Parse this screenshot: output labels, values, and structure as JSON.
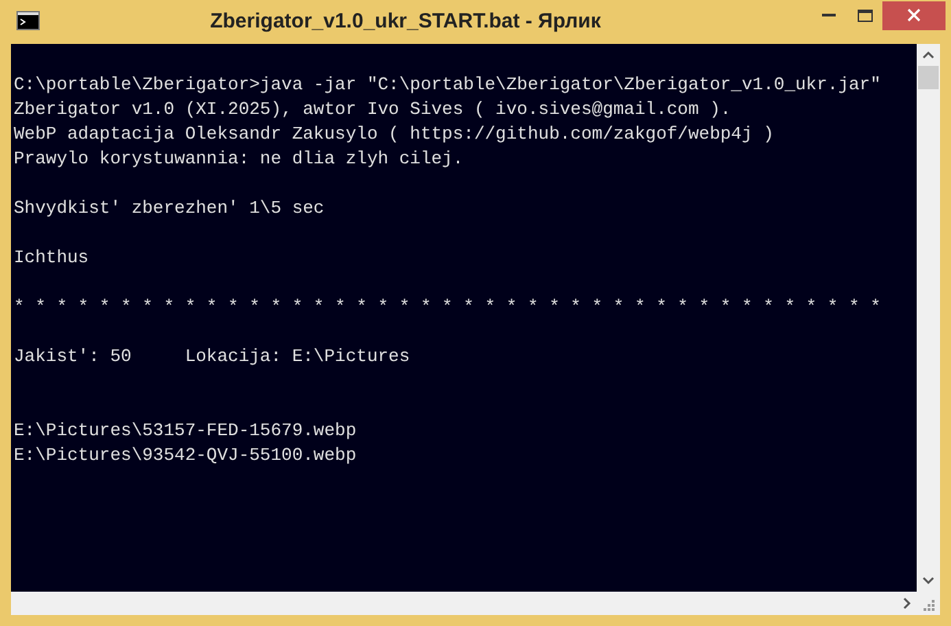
{
  "window": {
    "title": "Zberigator_v1.0_ukr_START.bat - Ярлик"
  },
  "console": {
    "lines": [
      {
        "kind": "blank"
      },
      {
        "kind": "text",
        "text": "C:\\portable\\Zberigator>java -jar \"C:\\portable\\Zberigator\\Zberigator_v1.0_ukr.jar\""
      },
      {
        "kind": "text",
        "text": "Zberigator v1.0 (XI.2025), awtor Ivo Sives ( ivo.sives@gmail.com )."
      },
      {
        "kind": "text",
        "text": "WebP adaptacija Oleksandr Zakusylo ( https://github.com/zakgof/webp4j )"
      },
      {
        "kind": "text",
        "text": "Prawylo korystuwannia: ne dlia zlyh cilej."
      },
      {
        "kind": "blank"
      },
      {
        "kind": "text",
        "text": "Shvydkist' zberezhen' 1\\5 sec"
      },
      {
        "kind": "blank"
      },
      {
        "kind": "text",
        "text": "Ichthus"
      },
      {
        "kind": "blank"
      },
      {
        "kind": "text",
        "text": "* * * * * * * * * * * * * * * * * * * * * * * * * * * * * * * * * * * * * * * * *"
      },
      {
        "kind": "blank"
      },
      {
        "kind": "text",
        "text": "Jakist': 50     Lokacija: E:\\Pictures"
      },
      {
        "kind": "blank"
      },
      {
        "kind": "blank"
      },
      {
        "kind": "text",
        "text": "E:\\Pictures\\53157-FED-15679.webp"
      },
      {
        "kind": "text",
        "text": "E:\\Pictures\\93542-QVJ-55100.webp"
      }
    ]
  }
}
